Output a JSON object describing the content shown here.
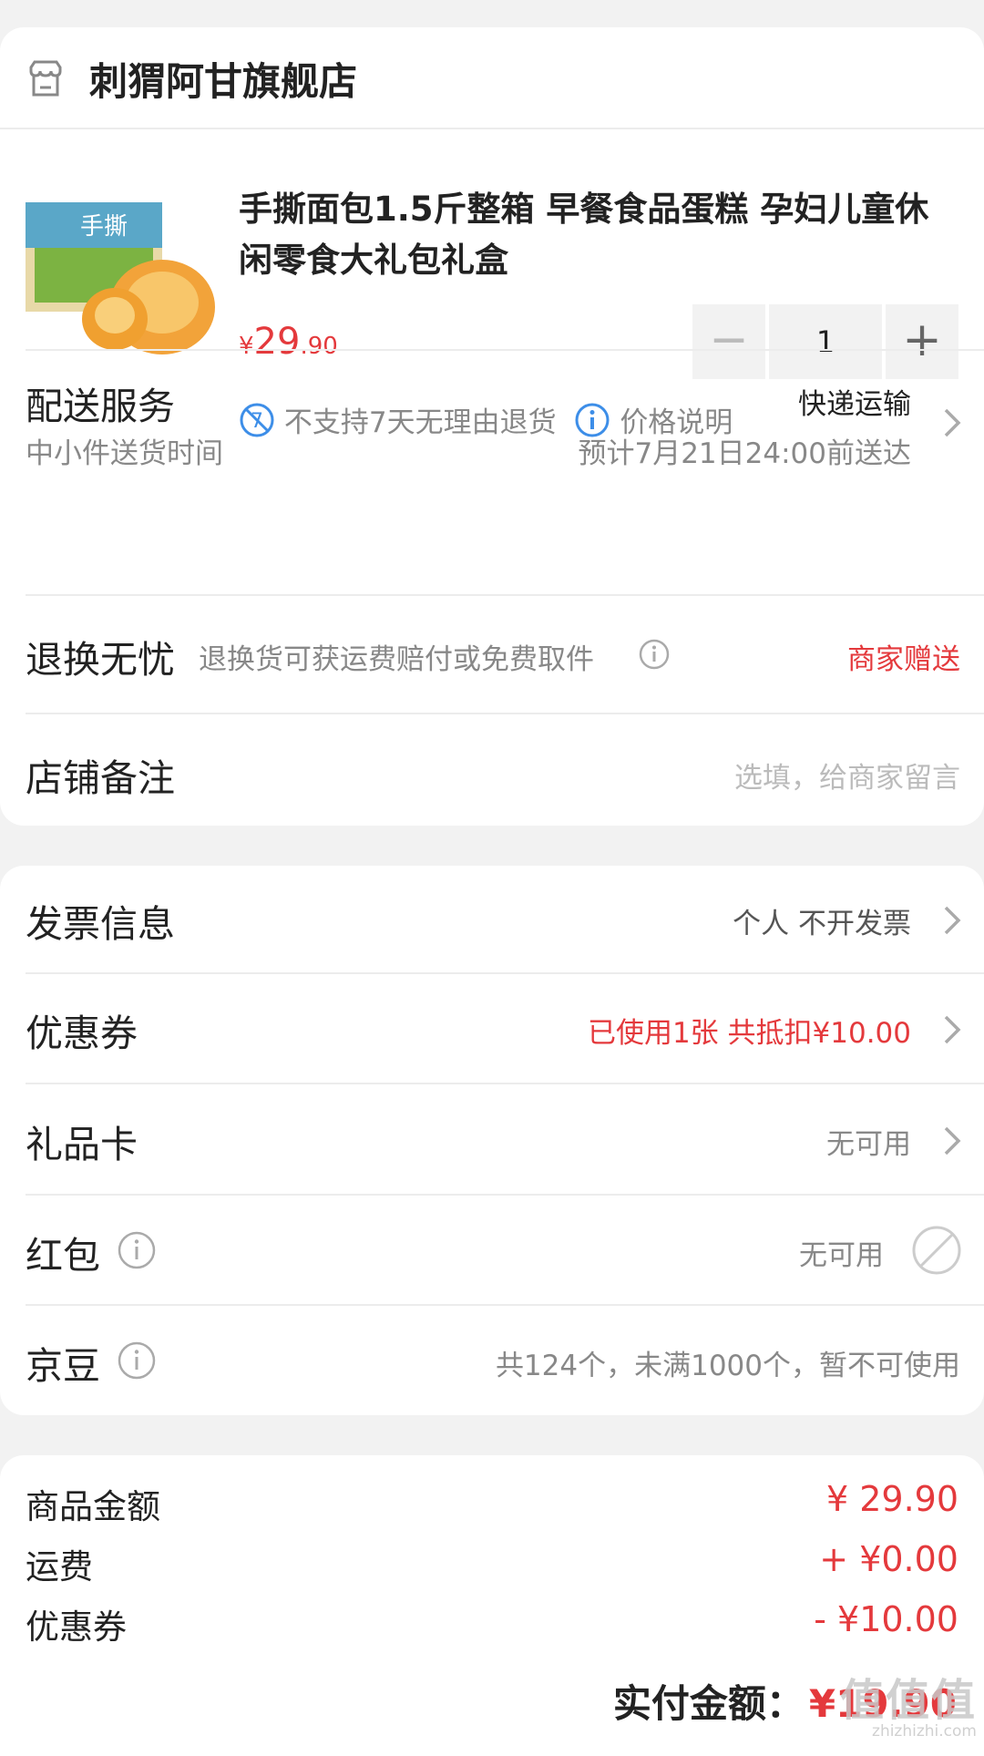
{
  "store": {
    "name": "刺猬阿甘旗舰店",
    "icon": "store-icon"
  },
  "product": {
    "title": "手撕面包1.5斤整箱 早餐食品蛋糕 孕妇儿童休闲零食大礼包礼盒",
    "price_currency": "¥",
    "price_integer": "29",
    "price_decimal": ".90",
    "quantity": "1",
    "minus_label": "−",
    "plus_label": "+",
    "tag_no_return": "不支持7天无理由退货",
    "tag_price_info": "价格说明"
  },
  "delivery": {
    "label": "配送服务",
    "sub": "中小件送货时间",
    "method": "快递运输",
    "eta": "预计7月21日24:00前送达"
  },
  "returns": {
    "label": "退换无忧",
    "desc": "退换货可获运费赔付或免费取件",
    "value": "商家赠送"
  },
  "remark": {
    "label": "店铺备注",
    "placeholder": "选填，给商家留言"
  },
  "invoice": {
    "label": "发票信息",
    "value": "个人 不开发票"
  },
  "coupon": {
    "label": "优惠券",
    "value": "已使用1张 共抵扣¥10.00"
  },
  "giftcard": {
    "label": "礼品卡",
    "value": "无可用"
  },
  "redpacket": {
    "label": "红包",
    "value": "无可用"
  },
  "jingdou": {
    "label": "京豆",
    "value": "共124个，未满1000个，暂不可使用"
  },
  "summary": {
    "goods_label": "商品金额",
    "goods_value": "¥ 29.90",
    "shipping_label": "运费",
    "shipping_value": "+ ¥0.00",
    "coupon_label": "优惠券",
    "coupon_value": "- ¥10.00",
    "total_label": "实付金额：",
    "total_value": "¥19.90"
  },
  "watermark": {
    "big": "值值值",
    "small": "zhizhizhi.com"
  },
  "colors": {
    "accent_red": "#e4393c",
    "icon_blue": "#3d8ee8",
    "page_bg": "#f2f2f2"
  }
}
